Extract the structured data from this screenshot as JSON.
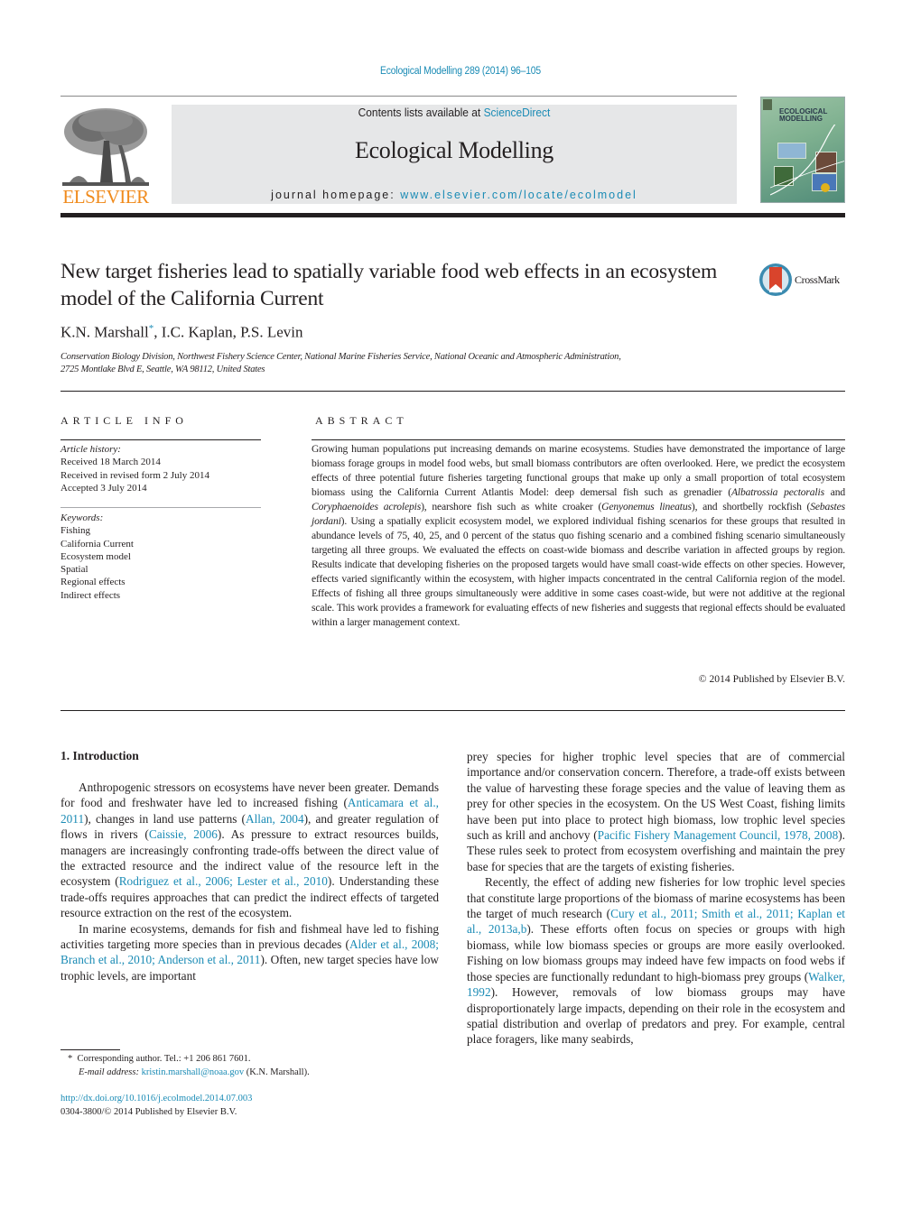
{
  "header": {
    "journal_reference": "Ecological Modelling 289 (2014) 96–105",
    "contents_prefix": "Contents lists available at ",
    "contents_link": "ScienceDirect",
    "journal_title": "Ecological Modelling",
    "homepage_prefix": "journal homepage: ",
    "homepage_link": "www.elsevier.com/locate/ecolmodel",
    "publisher_logo_text": "ELSEVIER",
    "cover_title_line1": "ECOLOGICAL",
    "cover_title_line2": "MODELLING",
    "colors": {
      "link": "#1a8bb5",
      "elsevier_orange": "#f08b1d",
      "masthead_bg": "#e6e7e8"
    }
  },
  "article": {
    "title": "New target fisheries lead to spatially variable food web effects in an ecosystem model of the California Current",
    "crossmark_label": "CrossMark",
    "authors": [
      {
        "name": "K.N. Marshall",
        "marker": "*"
      },
      {
        "name": "I.C. Kaplan"
      },
      {
        "name": "P.S. Levin"
      }
    ],
    "author_sep": ", ",
    "affiliation_line1": "Conservation Biology Division, Northwest Fishery Science Center, National Marine Fisheries Service, National Oceanic and Atmospheric Administration,",
    "affiliation_line2": "2725 Montlake Blvd E, Seattle, WA 98112, United States"
  },
  "article_info": {
    "heading": "ARTICLE INFO",
    "history_label": "Article history:",
    "history": [
      "Received 18 March 2014",
      "Received in revised form 2 July 2014",
      "Accepted 3 July 2014"
    ],
    "keywords_label": "Keywords:",
    "keywords": [
      "Fishing",
      "California Current",
      "Ecosystem model",
      "Spatial",
      "Regional effects",
      "Indirect effects"
    ]
  },
  "abstract": {
    "heading": "ABSTRACT",
    "segments": [
      {
        "text": "Growing human populations put increasing demands on marine ecosystems. Studies have demonstrated the importance of large biomass forage groups in model food webs, but small biomass contributors are often overlooked. Here, we predict the ecosystem effects of three potential future fisheries targeting functional groups that make up only a small proportion of total ecosystem biomass using the California Current Atlantis Model: deep demersal fish such as grenadier ("
      },
      {
        "text": "Albatrossia pectoralis",
        "italic": true
      },
      {
        "text": " and "
      },
      {
        "text": "Coryphaenoides acrolepis",
        "italic": true
      },
      {
        "text": "), nearshore fish such as white croaker ("
      },
      {
        "text": "Genyonemus lineatus",
        "italic": true
      },
      {
        "text": "), and shortbelly rockfish ("
      },
      {
        "text": "Sebastes jordani",
        "italic": true
      },
      {
        "text": "). Using a spatially explicit ecosystem model, we explored individual fishing scenarios for these groups that resulted in abundance levels of 75, 40, 25, and 0 percent of the status quo fishing scenario and a combined fishing scenario simultaneously targeting all three groups. We evaluated the effects on coast-wide biomass and describe variation in affected groups by region. Results indicate that developing fisheries on the proposed targets would have small coast-wide effects on other species. However, effects varied significantly within the ecosystem, with higher impacts concentrated in the central California region of the model. Effects of fishing all three groups simultaneously were additive in some cases coast-wide, but were not additive at the regional scale. This work provides a framework for evaluating effects of new fisheries and suggests that regional effects should be evaluated within a larger management context."
      }
    ],
    "copyright": "© 2014 Published by Elsevier B.V."
  },
  "introduction": {
    "heading": "1.  Introduction",
    "left_paragraphs": [
      [
        {
          "text": "Anthropogenic stressors on ecosystems have never been greater. Demands for food and freshwater have led to increased fishing ("
        },
        {
          "text": "Anticamara et al., 2011",
          "link": true
        },
        {
          "text": "), changes in land use patterns ("
        },
        {
          "text": "Allan, 2004",
          "link": true
        },
        {
          "text": "), and greater regulation of flows in rivers ("
        },
        {
          "text": "Caissie, 2006",
          "link": true
        },
        {
          "text": "). As pressure to extract resources builds, managers are increasingly confronting trade-offs between the direct value of the extracted resource and the indirect value of the resource left in the ecosystem ("
        },
        {
          "text": "Rodriguez et al., 2006; Lester et al., 2010",
          "link": true
        },
        {
          "text": "). Understanding these trade-offs requires approaches that can predict the indirect effects of targeted resource extraction on the rest of the ecosystem."
        }
      ],
      [
        {
          "text": "In marine ecosystems, demands for fish and fishmeal have led to fishing activities targeting more species than in previous decades ("
        },
        {
          "text": "Alder et al., 2008; Branch et al., 2010; Anderson et al., 2011",
          "link": true
        },
        {
          "text": "). Often, new target species have low trophic levels, are important"
        }
      ]
    ],
    "right_paragraphs": [
      [
        {
          "text": "prey species for higher trophic level species that are of commercial importance and/or conservation concern. Therefore, a trade-off exists between the value of harvesting these forage species and the value of leaving them as prey for other species in the ecosystem. On the US West Coast, fishing limits have been put into place to protect high biomass, low trophic level species such as krill and anchovy ("
        },
        {
          "text": "Pacific Fishery Management Council, 1978, 2008",
          "link": true
        },
        {
          "text": "). These rules seek to protect from ecosystem overfishing and maintain the prey base for species that are the targets of existing fisheries."
        }
      ],
      [
        {
          "text": "Recently, the effect of adding new fisheries for low trophic level species that constitute large proportions of the biomass of marine ecosystems has been the target of much research ("
        },
        {
          "text": "Cury et al., 2011; Smith et al., 2011; Kaplan et al., 2013a,b",
          "link": true
        },
        {
          "text": "). These efforts often focus on species or groups with high biomass, while low biomass species or groups are more easily overlooked. Fishing on low biomass groups may indeed have few impacts on food webs if those species are functionally redundant to high-biomass prey groups ("
        },
        {
          "text": "Walker, 1992",
          "link": true
        },
        {
          "text": "). However, removals of low biomass groups may have disproportionately large impacts, depending on their role in the ecosystem and spatial distribution and overlap of predators and prey. For example, central place foragers, like many seabirds,"
        }
      ]
    ]
  },
  "footnote": {
    "marker": "*",
    "corresponding": "Corresponding author. Tel.: +1 206 861 7601.",
    "email_label": "E-mail address: ",
    "email": "kristin.marshall@noaa.gov",
    "email_suffix": " (K.N. Marshall).",
    "doi": "http://dx.doi.org/10.1016/j.ecolmodel.2014.07.003",
    "issn_line": "0304-3800/© 2014 Published by Elsevier B.V."
  }
}
